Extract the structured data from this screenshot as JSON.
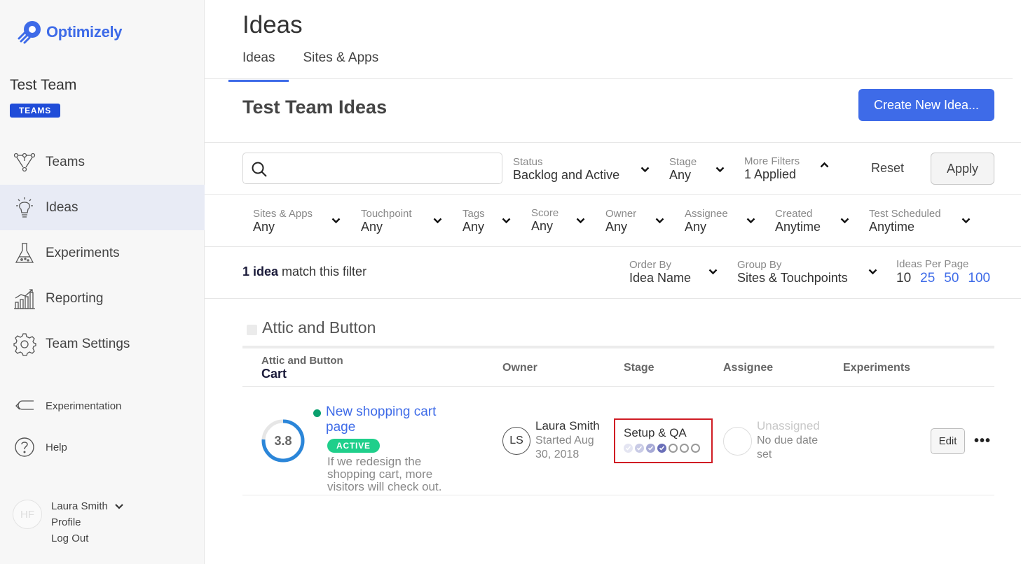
{
  "brand": {
    "name": "Optimizely",
    "color": "#3e6be8"
  },
  "sidebar": {
    "team_name": "Test Team",
    "team_badge": "TEAMS",
    "nav": [
      {
        "label": "Teams",
        "icon": "teams-icon"
      },
      {
        "label": "Ideas",
        "icon": "lightbulb-icon",
        "active": true
      },
      {
        "label": "Experiments",
        "icon": "flask-icon"
      },
      {
        "label": "Reporting",
        "icon": "chart-icon"
      },
      {
        "label": "Team Settings",
        "icon": "gear-icon"
      }
    ],
    "experimentation_label": "Experimentation",
    "help_label": "Help",
    "user": {
      "initials": "HF",
      "name": "Laura Smith",
      "profile_label": "Profile",
      "logout_label": "Log Out"
    }
  },
  "header": {
    "title": "Ideas",
    "tabs": [
      {
        "label": "Ideas",
        "active": true
      },
      {
        "label": "Sites & Apps"
      }
    ]
  },
  "section": {
    "title": "Test Team Ideas",
    "create_label": "Create New Idea..."
  },
  "filters": {
    "search_placeholder": "",
    "status": {
      "label": "Status",
      "value": "Backlog and Active"
    },
    "stage": {
      "label": "Stage",
      "value": "Any"
    },
    "more": {
      "label": "More Filters",
      "value": "1 Applied"
    },
    "reset_label": "Reset",
    "apply_label": "Apply",
    "secondary": [
      {
        "label": "Sites & Apps",
        "value": "Any"
      },
      {
        "label": "Touchpoint",
        "value": "Any"
      },
      {
        "label": "Tags",
        "value": "Any"
      },
      {
        "label": "Score",
        "value": "Any"
      },
      {
        "label": "Owner",
        "value": "Any"
      },
      {
        "label": "Assignee",
        "value": "Any"
      },
      {
        "label": "Created",
        "value": "Anytime"
      },
      {
        "label": "Test Scheduled",
        "value": "Anytime"
      }
    ]
  },
  "results": {
    "count_bold": "1 idea",
    "count_rest": " match this filter",
    "order_by": {
      "label": "Order By",
      "value": "Idea Name"
    },
    "group_by": {
      "label": "Group By",
      "value": "Sites & Touchpoints"
    },
    "per_page": {
      "label": "Ideas Per Page",
      "options": [
        "10",
        "25",
        "50",
        "100"
      ],
      "current": "10"
    }
  },
  "group": {
    "title": "Attic and Button",
    "site": "Attic and Button",
    "touchpoint": "Cart",
    "columns": {
      "owner": "Owner",
      "stage": "Stage",
      "assignee": "Assignee",
      "experiments": "Experiments"
    }
  },
  "idea": {
    "score": "3.8",
    "score_fraction": 0.76,
    "title": "New shopping cart page",
    "status_badge": "ACTIVE",
    "description": "If we redesign the shopping cart, more visitors will check out.",
    "owner_initials": "LS",
    "owner_name": "Laura Smith",
    "owner_started": "Started Aug 30, 2018",
    "stage": "Setup & QA",
    "stage_steps_total": 7,
    "stage_steps_done": 4,
    "assignee": "Unassigned",
    "due": "No due date set",
    "edit_label": "Edit",
    "more_label": "•••"
  }
}
